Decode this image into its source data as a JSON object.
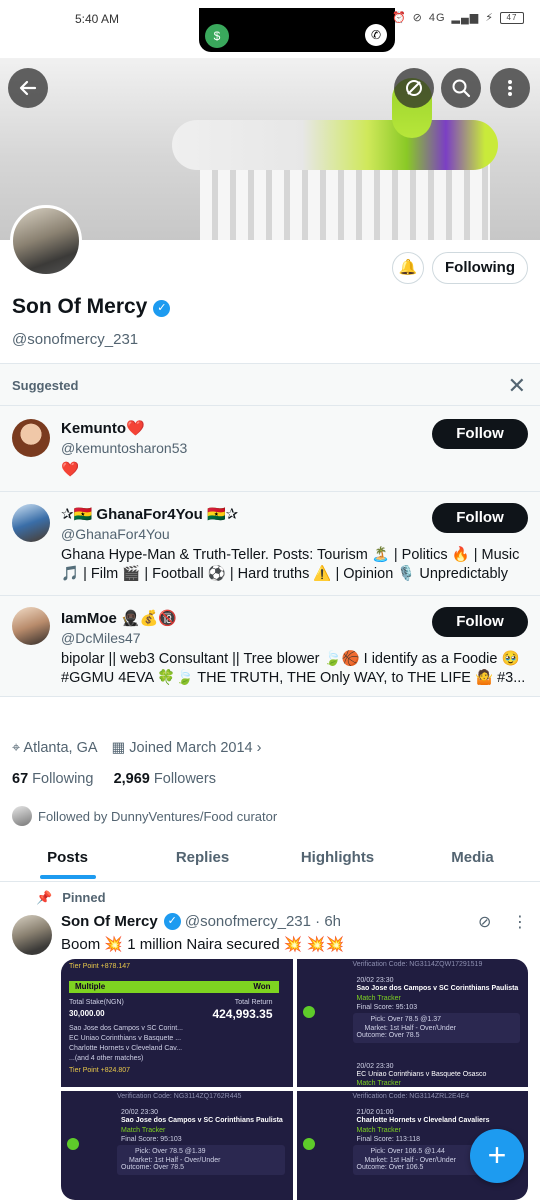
{
  "status_bar": {
    "time": "5:40 AM",
    "network": "4G",
    "battery": "47"
  },
  "header": {
    "back_icon": "arrow-left-icon",
    "grok_icon": "grok-icon",
    "search_icon": "search-icon",
    "more_icon": "more-vertical-icon"
  },
  "profile": {
    "display_name": "Son Of Mercy",
    "handle": "@sonofmercy_231",
    "following_label": "Following",
    "location": "Atlanta, GA",
    "joined": "Joined March 2014",
    "following_count": "67",
    "following_label_stat": "Following",
    "followers_count": "2,969",
    "followers_label": "Followers",
    "followed_by": "Followed by DunnyVentures/Food curator"
  },
  "suggested": {
    "title": "Suggested",
    "follow_label": "Follow",
    "items": [
      {
        "name": "Kemunto❤️",
        "handle": "@kemuntosharon53",
        "bio": "❤️"
      },
      {
        "name": "✰🇬🇭 GhanaFor4You 🇬🇭✰",
        "handle": "@GhanaFor4You",
        "bio": "Ghana Hype-Man & Truth-Teller.  Posts: Tourism 🏝️ | Politics 🔥 | Music 🎵 | Film 🎬 | Football ⚽ | Hard truths ⚠️ | Opinion 🎙️ Unpredictably T..."
      },
      {
        "name": "IamMoe 🥷🏿💰🔞",
        "handle": "@DcMiles47",
        "bio": "bipolar || web3 Consultant || Tree blower 🍃🏀  I identify as a Foodie 🥹 #GGMU 4EVA 🍀🍃 THE TRUTH, THE Only WAY, to THE LIFE 🤷 #3..."
      }
    ]
  },
  "tabs": [
    "Posts",
    "Replies",
    "Highlights",
    "Media"
  ],
  "post": {
    "pinned_label": "Pinned",
    "author": "Son Of Mercy",
    "handle": "@sonofmercy_231",
    "time": "· 6h",
    "text": "Boom 💥 1 million Naira secured  💥 💥💥",
    "tile1": {
      "tier_top": "Tier Point +878.147",
      "type": "Multiple",
      "won": "Won",
      "stake_label": "Total Stake(NGN)",
      "stake": "30,000.00",
      "return_label": "Total Return",
      "return": "424,993.35",
      "match1": "Sao Jose dos Campos v SC Corint...",
      "match2": "EC Uniao Corinthians v Basquete ...",
      "match3": "Charlotte Hornets v Cleveland Cav...",
      "more": "...(and 4 other matches)",
      "tier_bottom": "Tier Point +824.807"
    },
    "tile2": {
      "header": "Verification Code: NG3114ZQW17291519",
      "date": "20/02 23:30",
      "match": "Sao Jose dos Campos v SC Corinthians Paulista",
      "tracker": "Match Tracker",
      "score": "Final Score:  95:103",
      "pick": "Pick:   Over 78.5 @1.37",
      "market": "Market:   1st Half - Over/Under",
      "outcome": "Outcome:   Over 78.5",
      "date2": "20/02 23:30",
      "match2": "EC Uniao Corinthians v Basquete Osasco",
      "tracker2": "Match Tracker"
    },
    "tile3": {
      "header": "Verification Code: NG3114ZQ1762R445",
      "date": "20/02 23:30",
      "match": "Sao Jose dos Campos v SC Corinthians Paulista",
      "tracker": "Match Tracker",
      "score": "Final Score:  95:103",
      "pick": "Pick:   Over 78.5 @1.39",
      "market": "Market:   1st Half - Over/Under",
      "outcome": "Outcome:   Over 78.5"
    },
    "tile4": {
      "header": "Verification Code: NG3114ZRL2E4E4",
      "date": "21/02 01:00",
      "match": "Charlotte Hornets v Cleveland Cavaliers",
      "tracker": "Match Tracker",
      "score": "Final Score:  113:118",
      "pick": "Pick:   Over 106.5 @1.44",
      "market": "Market:   1st Half - Over/Under",
      "outcome": "Outcome:   Over 106.5"
    }
  },
  "fab": {
    "icon": "plus-icon",
    "label": "+"
  },
  "colors": {
    "accent": "#1d9bf0",
    "text": "#0f1419",
    "muted": "#536471",
    "won_green": "#7ed321",
    "tile_bg": "#201d40"
  }
}
